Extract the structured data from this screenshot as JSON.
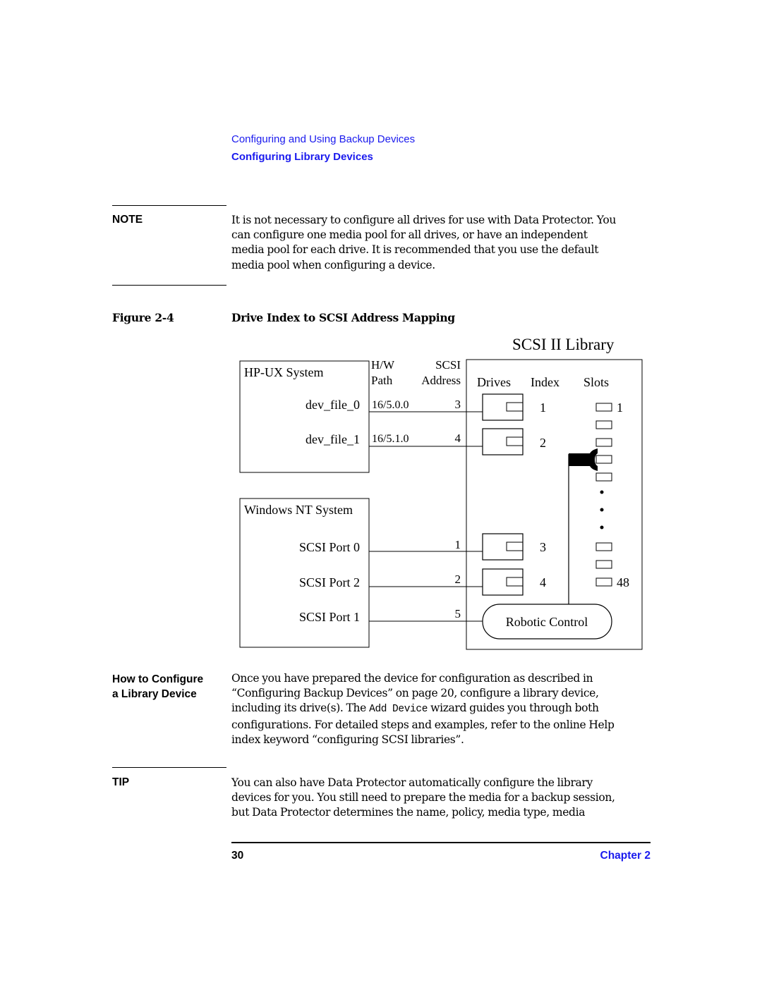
{
  "header": {
    "section": "Configuring and Using Backup Devices",
    "subsection": "Configuring Library Devices"
  },
  "note": {
    "label": "NOTE",
    "lines": [
      "It is not necessary to configure all drives for use with Data Protector. You",
      "can configure one media pool for all drives, or have an independent",
      "media pool for each drive. It is recommended that you use the default",
      "media pool when configuring a device."
    ]
  },
  "figure": {
    "label": "Figure 2-4",
    "title": "Drive Index to SCSI Address Mapping",
    "library_title": "SCSI II Library",
    "hpux": {
      "title": "HP-UX System",
      "col_hw_line1": "H/W",
      "col_hw_line2": "Path",
      "col_scsi_line1": "SCSI",
      "col_scsi_line2": "Address",
      "rows": [
        {
          "device": "dev_file_0",
          "hw_path": "16/5.0.0",
          "scsi": "3"
        },
        {
          "device": "dev_file_1",
          "hw_path": "16/5.1.0",
          "scsi": "4"
        }
      ]
    },
    "windows": {
      "title": "Windows NT System",
      "rows": [
        {
          "port": "SCSI Port 0",
          "scsi": "1"
        },
        {
          "port": "SCSI Port 2",
          "scsi": "2"
        },
        {
          "port": "SCSI Port 1",
          "scsi": "5"
        }
      ]
    },
    "library": {
      "col_drives": "Drives",
      "col_index": "Index",
      "col_slots": "Slots",
      "drive_indexes": [
        "1",
        "2",
        "3",
        "4"
      ],
      "slot_first": "1",
      "slot_last": "48",
      "robotic_control": "Robotic Control"
    }
  },
  "how_to": {
    "label_line1": "How to Configure",
    "label_line2": "a Library Device",
    "line1": "Once you have prepared the device for configuration as described in",
    "line2": "“Configuring Backup Devices” on page 20, configure a library device,",
    "line3_pre": "including its drive(s). The ",
    "line3_code": "Add Device",
    "line3_post": " wizard guides you through both",
    "line4": "configurations. For detailed steps and examples, refer to the online Help",
    "line5": "index keyword “configuring SCSI libraries”."
  },
  "tip": {
    "label": "TIP",
    "lines": [
      "You can also have Data Protector automatically configure the library",
      "devices for you. You still need to prepare the media for a backup session,",
      "but Data Protector determines the name, policy, media type, media"
    ]
  },
  "footer": {
    "page_number": "30",
    "chapter": "Chapter 2"
  }
}
